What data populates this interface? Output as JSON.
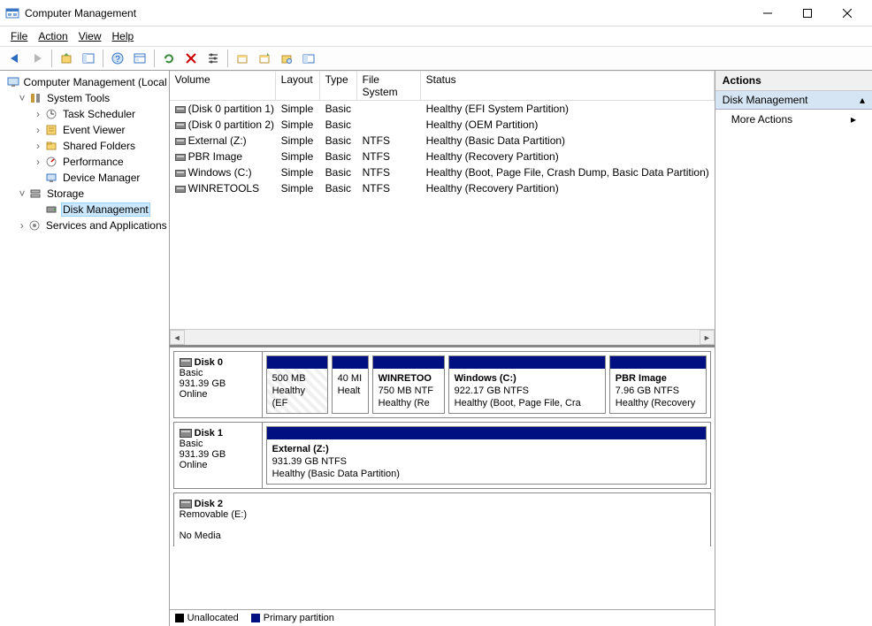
{
  "window": {
    "title": "Computer Management"
  },
  "menu": {
    "file": "File",
    "action": "Action",
    "view": "View",
    "help": "Help"
  },
  "tree": {
    "root": "Computer Management (Local",
    "sys": "System Tools",
    "task": "Task Scheduler",
    "event": "Event Viewer",
    "shared": "Shared Folders",
    "perf": "Performance",
    "devmgr": "Device Manager",
    "storage": "Storage",
    "diskmgmt": "Disk Management",
    "services": "Services and Applications"
  },
  "cols": {
    "volume": "Volume",
    "layout": "Layout",
    "type": "Type",
    "fs": "File System",
    "status": "Status"
  },
  "rows": [
    {
      "v": "(Disk 0 partition 1)",
      "l": "Simple",
      "t": "Basic",
      "f": "",
      "s": "Healthy (EFI System Partition)"
    },
    {
      "v": "(Disk 0 partition 2)",
      "l": "Simple",
      "t": "Basic",
      "f": "",
      "s": "Healthy (OEM Partition)"
    },
    {
      "v": "External (Z:)",
      "l": "Simple",
      "t": "Basic",
      "f": "NTFS",
      "s": "Healthy (Basic Data Partition)"
    },
    {
      "v": "PBR Image",
      "l": "Simple",
      "t": "Basic",
      "f": "NTFS",
      "s": "Healthy (Recovery Partition)"
    },
    {
      "v": "Windows (C:)",
      "l": "Simple",
      "t": "Basic",
      "f": "NTFS",
      "s": "Healthy (Boot, Page File, Crash Dump, Basic Data Partition)"
    },
    {
      "v": "WINRETOOLS",
      "l": "Simple",
      "t": "Basic",
      "f": "NTFS",
      "s": "Healthy (Recovery Partition)"
    }
  ],
  "disks": {
    "d0": {
      "name": "Disk 0",
      "type": "Basic",
      "size": "931.39 GB",
      "state": "Online"
    },
    "d1": {
      "name": "Disk 1",
      "type": "Basic",
      "size": "931.39 GB",
      "state": "Online"
    },
    "d2": {
      "name": "Disk 2",
      "type": "Removable (E:)",
      "nomedia": "No Media"
    }
  },
  "parts": {
    "p0a": {
      "l1": "500 MB",
      "l2": "Healthy (EF"
    },
    "p0b": {
      "l1": "40 MI",
      "l2": "Healt"
    },
    "p0c": {
      "n": "WINRETOO",
      "l1": "750 MB NTF",
      "l2": "Healthy (Re"
    },
    "p0d": {
      "n": "Windows  (C:)",
      "l1": "922.17 GB NTFS",
      "l2": "Healthy (Boot, Page File, Cra"
    },
    "p0e": {
      "n": "PBR Image",
      "l1": "7.96 GB NTFS",
      "l2": "Healthy (Recovery"
    },
    "p1a": {
      "n": "External  (Z:)",
      "l1": "931.39 GB NTFS",
      "l2": "Healthy (Basic Data Partition)"
    }
  },
  "legend": {
    "unalloc": "Unallocated",
    "primary": "Primary partition"
  },
  "actions": {
    "head": "Actions",
    "section": "Disk Management",
    "more": "More Actions"
  }
}
